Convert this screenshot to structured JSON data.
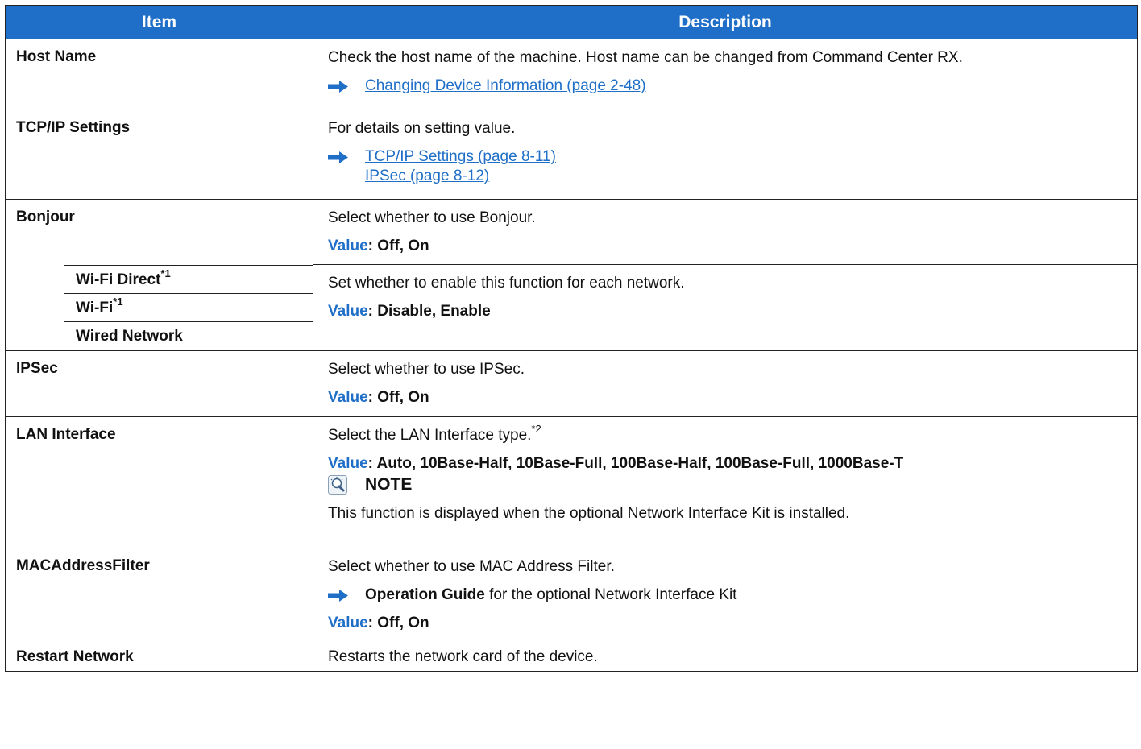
{
  "header": {
    "item": "Item",
    "description": "Description"
  },
  "rows": {
    "host_name": {
      "item": "Host Name",
      "desc": "Check the host name of the machine. Host name can be changed from Command Center RX.",
      "link": "Changing Device Information (page 2-48)"
    },
    "tcpip": {
      "item": "TCP/IP Settings",
      "desc": "For details on setting value.",
      "link1": "TCP/IP Settings (page 8-11)",
      "link2": "IPSec (page 8-12)"
    },
    "bonjour": {
      "item": "Bonjour",
      "desc": "Select whether to use Bonjour.",
      "value_key": "Value",
      "value_text": ": Off, On"
    },
    "bonjour_sub": {
      "wifi_direct": "Wi-Fi Direct",
      "wifi_direct_sup": "*1",
      "wifi": "Wi-Fi",
      "wifi_sup": "*1",
      "wired": "Wired Network",
      "desc": "Set whether to enable this function for each network.",
      "value_key": "Value",
      "value_text": ": Disable, Enable"
    },
    "ipsec": {
      "item": "IPSec",
      "desc": "Select whether to use IPSec.",
      "value_key": "Value",
      "value_text": ": Off, On"
    },
    "lan": {
      "item": "LAN Interface",
      "desc": "Select the LAN Interface type.",
      "desc_sup": "*2",
      "value_key": "Value",
      "value_text": ": Auto, 10Base-Half, 10Base-Full, 100Base-Half, 100Base-Full, 1000Base-T",
      "note_label": "NOTE",
      "note_text": "This function is displayed when the optional Network Interface Kit is installed."
    },
    "mac": {
      "item": "MACAddressFilter",
      "desc": "Select whether to use MAC Address Filter.",
      "ref_bold": "Operation Guide",
      "ref_text": " for the optional Network Interface Kit",
      "value_key": "Value",
      "value_text": ": Off, On"
    },
    "restart": {
      "item": "Restart Network",
      "desc": "Restarts the network card of the device."
    }
  },
  "icons": {
    "arrow": "right-arrow-icon",
    "note": "lightbulb-note-icon"
  },
  "colors": {
    "accent": "#1f6fc8"
  }
}
